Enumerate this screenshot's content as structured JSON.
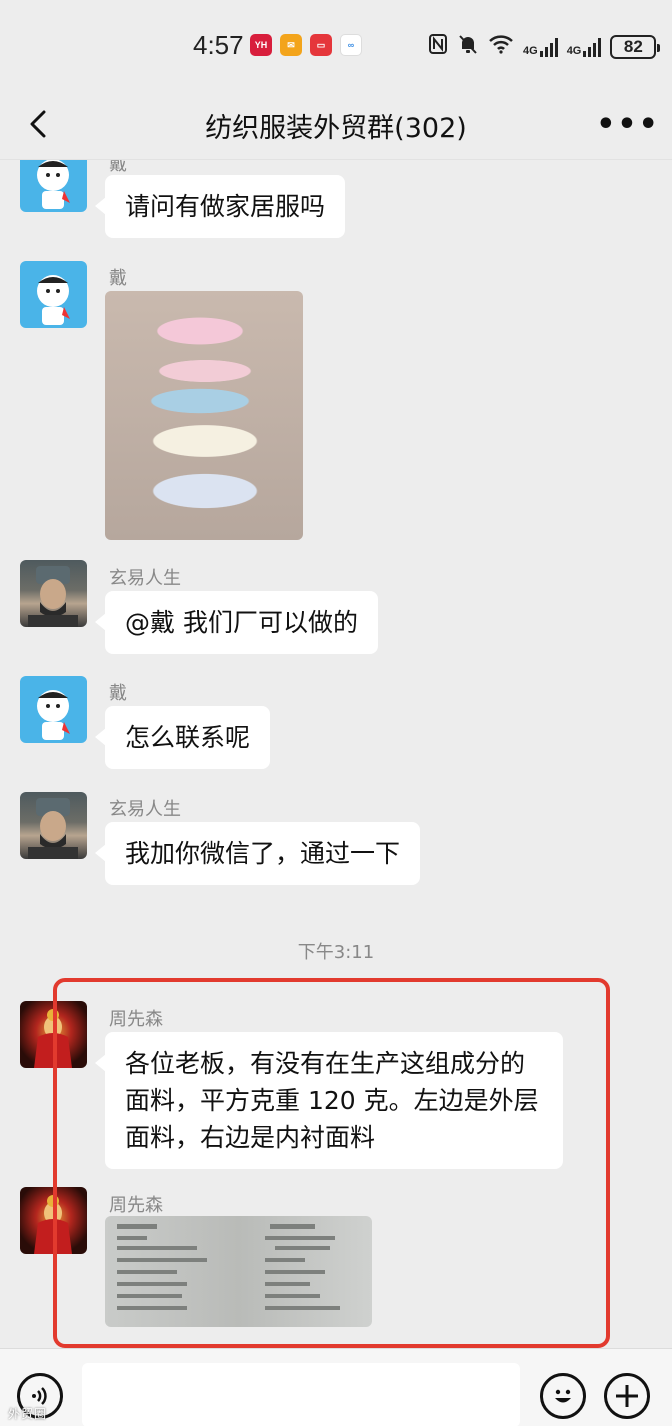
{
  "status_bar": {
    "time": "4:57",
    "notifications": [
      {
        "icon": "yh-app-icon",
        "text": "YH",
        "color": "#d81e3c"
      },
      {
        "icon": "mail-app-icon",
        "text": "✉",
        "color": "#f3a41b"
      },
      {
        "icon": "message-app-icon",
        "text": "▭",
        "color": "#e5363b"
      },
      {
        "icon": "cloud-app-icon",
        "text": "∞",
        "color": "#3b8de3"
      }
    ],
    "signal_label_1": "4G",
    "signal_label_2": "4G",
    "battery": "82"
  },
  "header": {
    "title": "纺织服装外贸群(302)",
    "more_label": "•••"
  },
  "messages": [
    {
      "sender": "戴",
      "text": "请问有做家居服吗"
    },
    {
      "sender": "戴",
      "image_icon": "clothing-photo"
    },
    {
      "sender": "玄易人生",
      "text": "@戴  我们厂可以做的"
    },
    {
      "sender": "戴",
      "text": "怎么联系呢"
    },
    {
      "sender": "玄易人生",
      "text": "我加你微信了，通过一下"
    },
    {
      "sender": "周先森",
      "text": "各位老板，有没有在生产这组成分的面料，平方克重 120 克。左边是外层面料，右边是内衬面料"
    },
    {
      "sender": "周先森",
      "image_icon": "fabric-label-photo"
    }
  ],
  "time_divider": "下午3:11",
  "input_bar": {
    "input_value": "",
    "watermark": "外贸圈"
  }
}
